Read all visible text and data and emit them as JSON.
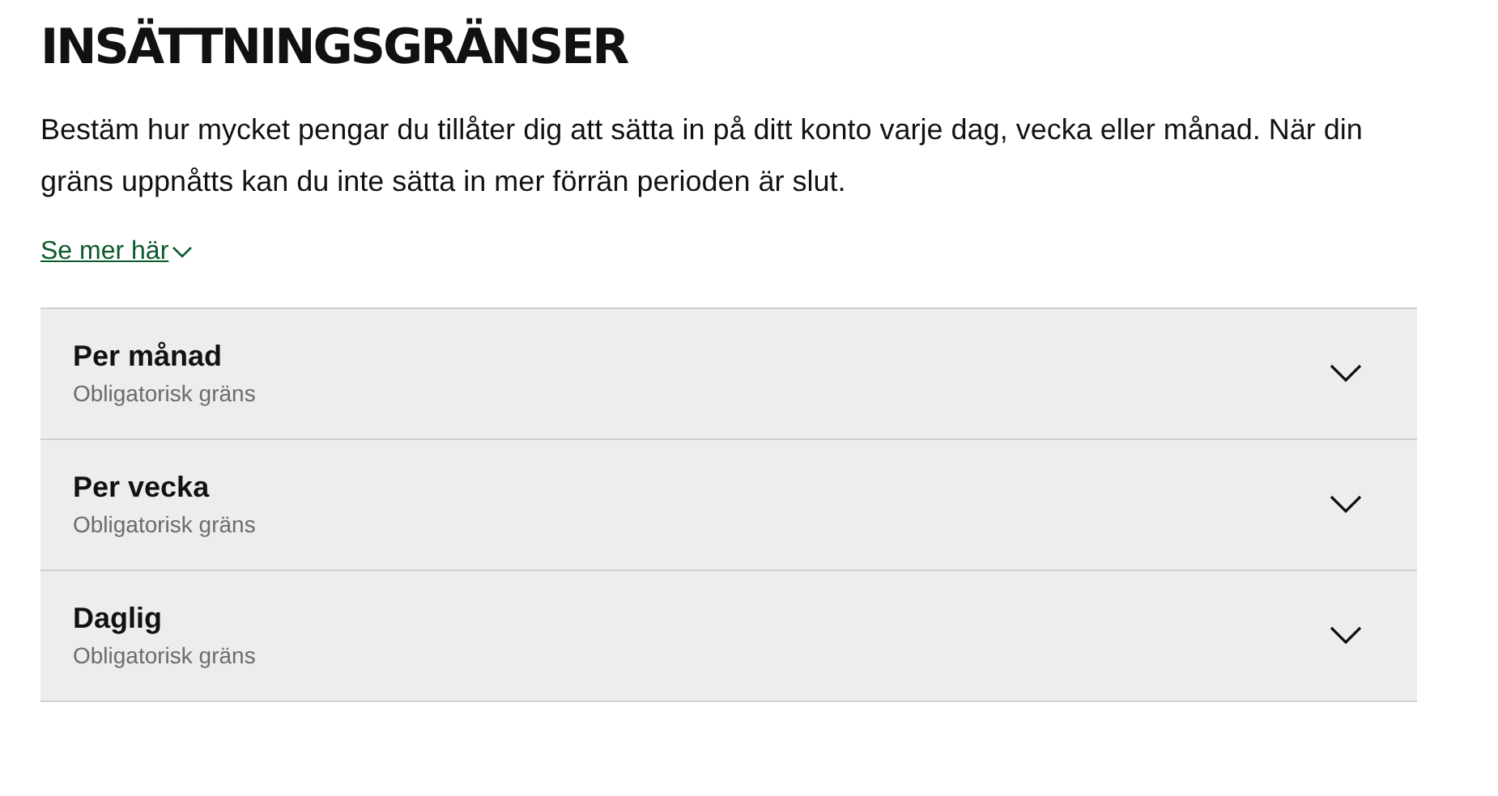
{
  "title": "INSÄTTNINGSGRÄNSER",
  "description": "Bestäm hur mycket pengar du tillåter dig att sätta in på ditt konto varje dag, vecka eller månad. När din gräns uppnåtts kan du inte sätta in mer förrän perioden är slut.",
  "more_link": {
    "label": "Se mer här",
    "expanded": false
  },
  "limits": [
    {
      "title": "Per månad",
      "subtitle": "Obligatorisk gräns",
      "expanded": false
    },
    {
      "title": "Per vecka",
      "subtitle": "Obligatorisk gräns",
      "expanded": false
    },
    {
      "title": "Daglig",
      "subtitle": "Obligatorisk gräns",
      "expanded": false
    }
  ]
}
